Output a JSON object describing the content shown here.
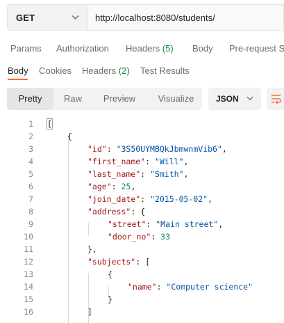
{
  "request": {
    "method": "GET",
    "url": "http://localhost:8080/students/"
  },
  "request_tabs": [
    {
      "label": "Params",
      "count": ""
    },
    {
      "label": "Authorization",
      "count": ""
    },
    {
      "label": "Headers",
      "count": "(5)"
    },
    {
      "label": "Body",
      "count": ""
    },
    {
      "label": "Pre-request S",
      "count": ""
    }
  ],
  "response_tabs": [
    {
      "label": "Body",
      "count": ""
    },
    {
      "label": "Cookies",
      "count": ""
    },
    {
      "label": "Headers",
      "count": "(2)"
    },
    {
      "label": "Test Results",
      "count": ""
    }
  ],
  "view_modes": [
    "Pretty",
    "Raw",
    "Preview",
    "Visualize"
  ],
  "active_view": "Pretty",
  "format": "JSON",
  "code_lines": [
    {
      "n": "1",
      "tokens": [
        [
          "pun",
          "["
        ]
      ]
    },
    {
      "n": "2",
      "tokens": [
        [
          "pun",
          "{"
        ]
      ]
    },
    {
      "n": "3",
      "tokens": [
        [
          "key",
          "\"id\""
        ],
        [
          "pun",
          ": "
        ],
        [
          "str",
          "\"3S50UYMBQkJbmwnmVib6\""
        ],
        [
          "pun",
          ","
        ]
      ]
    },
    {
      "n": "4",
      "tokens": [
        [
          "key",
          "\"first_name\""
        ],
        [
          "pun",
          ": "
        ],
        [
          "str",
          "\"Will\""
        ],
        [
          "pun",
          ","
        ]
      ]
    },
    {
      "n": "5",
      "tokens": [
        [
          "key",
          "\"last_name\""
        ],
        [
          "pun",
          ": "
        ],
        [
          "str",
          "\"Smith\""
        ],
        [
          "pun",
          ","
        ]
      ]
    },
    {
      "n": "6",
      "tokens": [
        [
          "key",
          "\"age\""
        ],
        [
          "pun",
          ": "
        ],
        [
          "num",
          "25"
        ],
        [
          "pun",
          ","
        ]
      ]
    },
    {
      "n": "7",
      "tokens": [
        [
          "key",
          "\"join_date\""
        ],
        [
          "pun",
          ": "
        ],
        [
          "str",
          "\"2015-05-02\""
        ],
        [
          "pun",
          ","
        ]
      ]
    },
    {
      "n": "8",
      "tokens": [
        [
          "key",
          "\"address\""
        ],
        [
          "pun",
          ": {"
        ]
      ]
    },
    {
      "n": "9",
      "tokens": [
        [
          "key",
          "\"street\""
        ],
        [
          "pun",
          ": "
        ],
        [
          "str",
          "\"Main street\""
        ],
        [
          "pun",
          ","
        ]
      ]
    },
    {
      "n": "10",
      "tokens": [
        [
          "key",
          "\"door_no\""
        ],
        [
          "pun",
          ": "
        ],
        [
          "num",
          "33"
        ]
      ]
    },
    {
      "n": "11",
      "tokens": [
        [
          "pun",
          "},"
        ]
      ]
    },
    {
      "n": "12",
      "tokens": [
        [
          "key",
          "\"subjects\""
        ],
        [
          "pun",
          ": ["
        ]
      ]
    },
    {
      "n": "13",
      "tokens": [
        [
          "pun",
          "{"
        ]
      ]
    },
    {
      "n": "14",
      "tokens": [
        [
          "key",
          "\"name\""
        ],
        [
          "pun",
          ": "
        ],
        [
          "str",
          "\"Computer science\""
        ]
      ]
    },
    {
      "n": "15",
      "tokens": [
        [
          "pun",
          "}"
        ]
      ]
    },
    {
      "n": "16",
      "tokens": [
        [
          "pun",
          "]"
        ]
      ]
    }
  ],
  "icons": {
    "method_dropdown": "chevron-down-icon",
    "format_dropdown": "chevron-down-icon",
    "wrap": "wrap-lines-icon"
  },
  "colors": {
    "accent": "#ff6c37",
    "count_green": "#0e8a3a",
    "json_key": "#a31515",
    "json_string": "#0451a5",
    "json_number": "#098658"
  }
}
